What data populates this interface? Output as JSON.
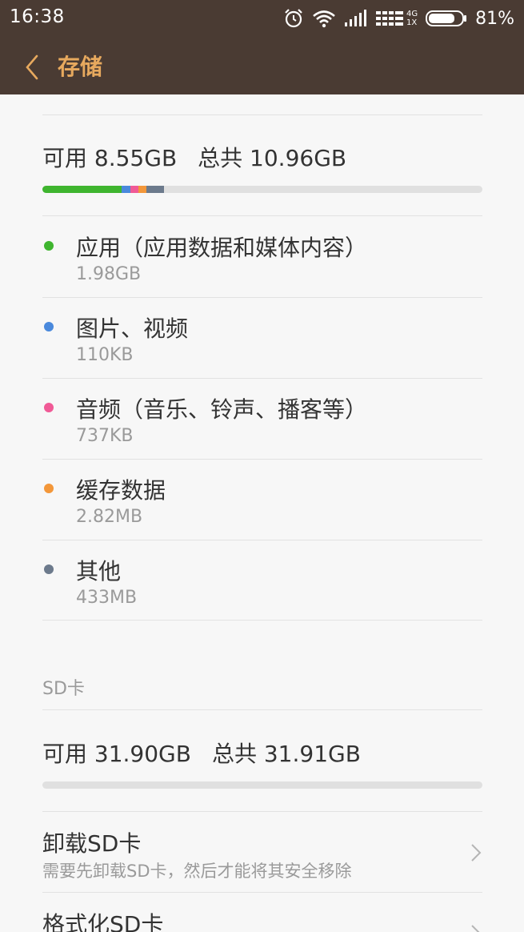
{
  "status_bar": {
    "time": "16:38",
    "battery_percent_text": "81%",
    "battery_level": 0.81,
    "network_top": "4G",
    "network_bottom": "1X",
    "icons": [
      "alarm-icon",
      "wifi-icon",
      "signal-icon",
      "signal-4g-icon",
      "battery-icon"
    ]
  },
  "header": {
    "title": "存储",
    "back_icon": "chevron-left-icon"
  },
  "internal": {
    "available_text": "可用 8.55GB",
    "total_text": "总共 10.96GB",
    "usage_fractions": [
      {
        "color": "#3fb52f",
        "fraction": 0.18
      },
      {
        "color": "#4a89dc",
        "fraction": 0.02
      },
      {
        "color": "#f05a96",
        "fraction": 0.018
      },
      {
        "color": "#f3973a",
        "fraction": 0.018
      },
      {
        "color": "#6c7a8c",
        "fraction": 0.04
      }
    ],
    "categories": [
      {
        "name": "应用（应用数据和媒体内容）",
        "size": "1.98GB",
        "color": "#3fb52f"
      },
      {
        "name": "图片、视频",
        "size": "110KB",
        "color": "#4a89dc"
      },
      {
        "name": "音频（音乐、铃声、播客等）",
        "size": "737KB",
        "color": "#f05a96"
      },
      {
        "name": "缓存数据",
        "size": "2.82MB",
        "color": "#f3973a"
      },
      {
        "name": "其他",
        "size": "433MB",
        "color": "#6c7a8c"
      }
    ]
  },
  "sd": {
    "section_title": "SD卡",
    "available_text": "可用 31.90GB",
    "total_text": "总共 31.91GB",
    "usage_fraction": 0.0,
    "unmount": {
      "title": "卸载SD卡",
      "subtitle": "需要先卸载SD卡，然后才能将其安全移除"
    },
    "format": {
      "title": "格式化SD卡"
    }
  }
}
